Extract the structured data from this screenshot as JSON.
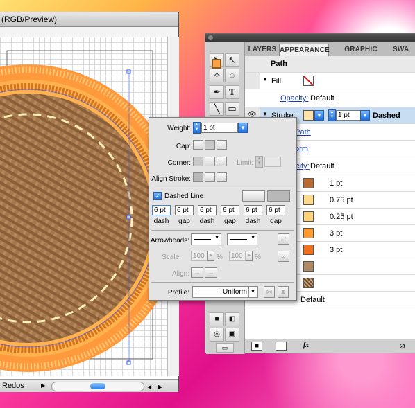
{
  "document": {
    "title": "(RGB/Preview)",
    "status_label": "Redos"
  },
  "panel": {
    "tabs": [
      "LAYERS",
      "APPEARANCE",
      "GRAPHIC STYLES",
      "SWA"
    ],
    "active_tab": "APPEARANCE",
    "object_label": "Path",
    "fill": {
      "label": "Fill:"
    },
    "opacity": {
      "label": "Opacity:",
      "value": "Default"
    },
    "stroke": {
      "label": "Stroke:",
      "weight": "1 pt",
      "style": "Dashed"
    },
    "hidden_links": [
      "t Path",
      "form",
      "acity:"
    ],
    "opacity2_value": "Default",
    "items": [
      {
        "color": "#b86a32",
        "value": "1 pt"
      },
      {
        "color": "#ffd98a",
        "value": "0.75 pt"
      },
      {
        "color": "#ffd27a",
        "value": "0.25 pt"
      },
      {
        "color": "#ff9a2e",
        "value": "3 pt"
      },
      {
        "color": "#f0701e",
        "value": "3 pt"
      },
      {
        "color": "#b08a63",
        "value": ""
      }
    ],
    "bottom_default": "Default",
    "fx_label": "fx"
  },
  "stroke_popup": {
    "weight_label": "Weight:",
    "weight_value": "1 pt",
    "cap_label": "Cap:",
    "corner_label": "Corner:",
    "limit_label": "Limit:",
    "align_label": "Align Stroke:",
    "dashed_label": "Dashed Line",
    "dashed_checked": true,
    "dash_values": [
      "6 pt",
      "6 pt",
      "6 pt",
      "6 pt",
      "6 pt",
      "6 pt"
    ],
    "dash_labels": [
      "dash",
      "gap",
      "dash",
      "gap",
      "dash",
      "gap"
    ],
    "arrowheads_label": "Arrowheads:",
    "scale_label": "Scale:",
    "scale_values": [
      "100",
      "100"
    ],
    "percent": "%",
    "align2_label": "Align:",
    "profile_label": "Profile:",
    "profile_value": "Uniform"
  },
  "icons": [
    "selection-arrow",
    "direct-select-arrow",
    "magic-wand",
    "lasso",
    "pen",
    "type",
    "line",
    "rectangle",
    "eye",
    "fx"
  ]
}
